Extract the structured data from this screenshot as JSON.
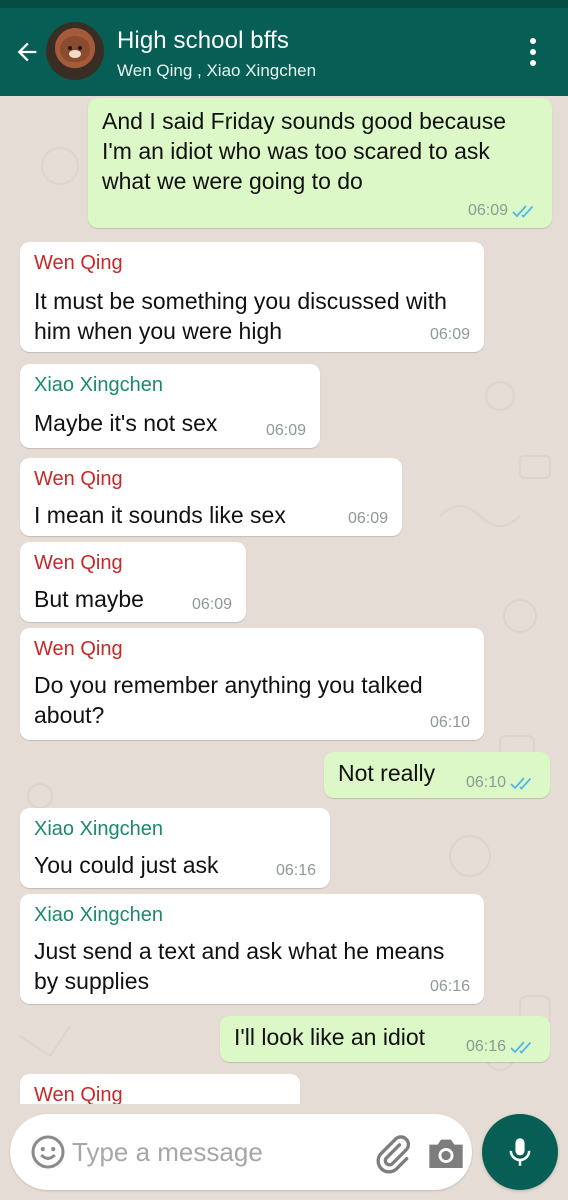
{
  "header": {
    "title": "High school bffs",
    "subtitle": "Wen Qing , Xiao Xingchen",
    "back_icon": "arrow-left-icon",
    "menu_icon": "more-vertical-icon"
  },
  "colors": {
    "header": "#075e54",
    "outgoing_bubble": "#dcf8c6",
    "incoming_bubble": "#ffffff",
    "wen_qing_name": "#c62828",
    "xiao_xingchen_name": "#1b8a6b",
    "read_ticks": "#4fb6ec"
  },
  "messages": [
    {
      "direction": "out",
      "text": "And I said Friday sounds good because I'm an idiot who was too scared to ask what we were going to do",
      "time": "06:09",
      "status": "read"
    },
    {
      "direction": "in",
      "sender": "Wen Qing",
      "text": "It must be something you discussed with him when you were high",
      "time": "06:09"
    },
    {
      "direction": "in",
      "sender": "Xiao Xingchen",
      "text": "Maybe it's not sex",
      "time": "06:09"
    },
    {
      "direction": "in",
      "sender": "Wen Qing",
      "text": "I mean it sounds like sex",
      "time": "06:09"
    },
    {
      "direction": "in",
      "sender": "Wen Qing",
      "text": "But maybe",
      "time": "06:09"
    },
    {
      "direction": "in",
      "sender": "Wen Qing",
      "text": "Do you remember anything you talked about?",
      "time": "06:10"
    },
    {
      "direction": "out",
      "text": "Not really",
      "time": "06:10",
      "status": "read"
    },
    {
      "direction": "in",
      "sender": "Xiao Xingchen",
      "text": "You could just ask",
      "time": "06:16"
    },
    {
      "direction": "in",
      "sender": "Xiao Xingchen",
      "text": "Just send a text and ask what he means by supplies",
      "time": "06:16"
    },
    {
      "direction": "out",
      "text": "I'll look like an idiot",
      "time": "06:16",
      "status": "read"
    },
    {
      "direction": "in",
      "sender": "Wen Qing",
      "text": "",
      "time": ""
    }
  ],
  "composer": {
    "placeholder": "Type a message",
    "value": "",
    "emoji_icon": "smiley-icon",
    "attach_icon": "paperclip-icon",
    "camera_icon": "camera-icon",
    "mic_icon": "microphone-icon"
  }
}
